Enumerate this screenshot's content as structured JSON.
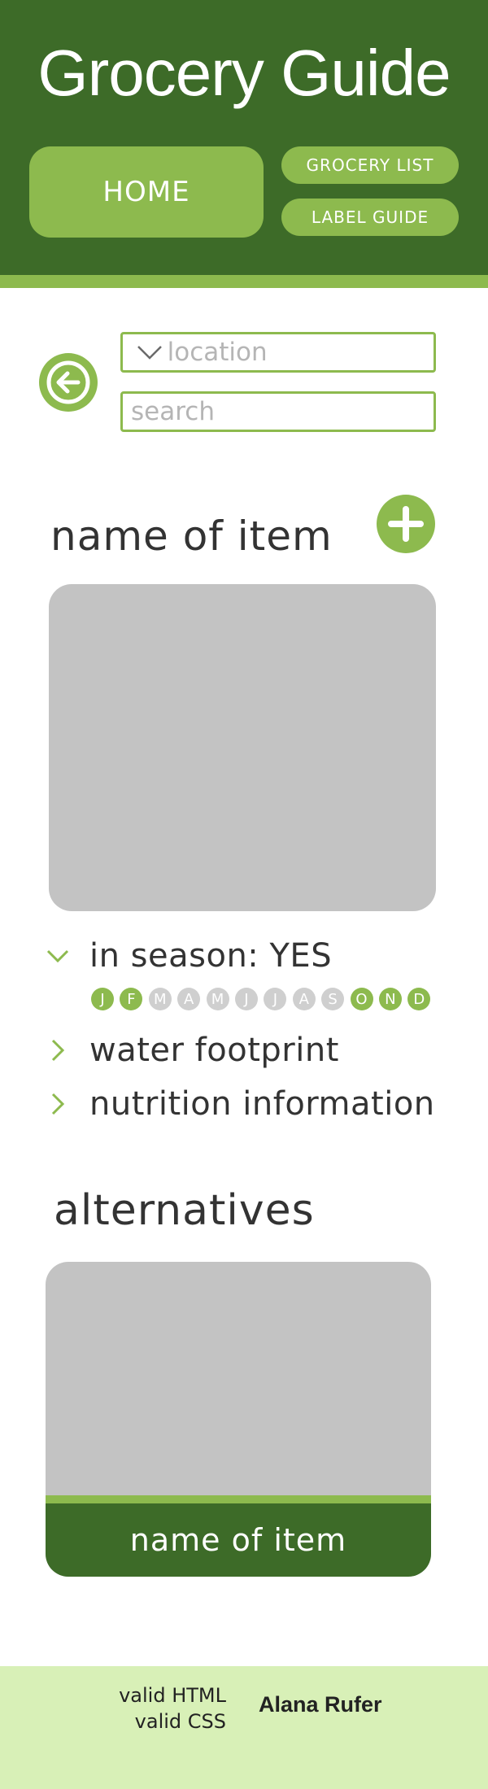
{
  "header": {
    "title": "Grocery Guide",
    "nav": {
      "home": "HOME",
      "grocery_list": "GROCERY LIST",
      "label_guide": "LABEL GUIDE"
    }
  },
  "search": {
    "location_placeholder": "location",
    "search_placeholder": "search"
  },
  "item": {
    "name": "name of item",
    "season": {
      "label": "in season: YES",
      "months": [
        {
          "letter": "J",
          "active": true
        },
        {
          "letter": "F",
          "active": true
        },
        {
          "letter": "M",
          "active": false
        },
        {
          "letter": "A",
          "active": false
        },
        {
          "letter": "M",
          "active": false
        },
        {
          "letter": "J",
          "active": false
        },
        {
          "letter": "J",
          "active": false
        },
        {
          "letter": "A",
          "active": false
        },
        {
          "letter": "S",
          "active": false
        },
        {
          "letter": "O",
          "active": true
        },
        {
          "letter": "N",
          "active": true
        },
        {
          "letter": "D",
          "active": true
        }
      ]
    },
    "water_footprint": "water footprint",
    "nutrition": "nutrition information"
  },
  "alternatives": {
    "title": "alternatives",
    "card_name": "name of item"
  },
  "footer": {
    "valid_html": "valid HTML",
    "valid_css": "valid CSS",
    "author": "Alana Rufer"
  },
  "icons": {
    "back": "arrow-left-icon",
    "add": "plus-icon",
    "dropdown": "chevron-down-icon",
    "expanded": "chevron-down-icon",
    "collapsed": "chevron-right-icon"
  },
  "colors": {
    "dark_green": "#3d6b28",
    "light_green": "#8dba4e",
    "footer_bg": "#d8f0b7",
    "placeholder_gray": "#c3c3c3",
    "month_inactive": "#cfcfcf"
  }
}
